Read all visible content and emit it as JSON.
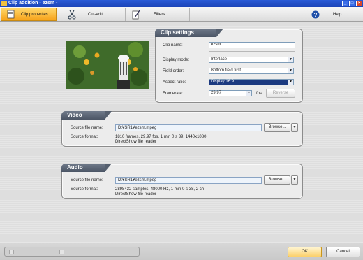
{
  "window": {
    "title": "Clip addition - ezsm -"
  },
  "toolbar": {
    "clip_properties": "Clip properties",
    "cut_edit": "Cut-edit",
    "filters": "Filters",
    "help": "Help..."
  },
  "clip_settings": {
    "title": "Clip settings",
    "clip_name_label": "Clip name:",
    "clip_name_value": "ezsm",
    "display_mode_label": "Display mode:",
    "display_mode_value": "Interlace",
    "field_order_label": "Field order:",
    "field_order_value": "Bottom field first",
    "aspect_ratio_label": "Aspect ratio:",
    "aspect_ratio_value": "Display 16:9",
    "framerate_label": "Framerate:",
    "framerate_value": "29.97",
    "framerate_unit": "fps",
    "reverse_button": "Reverse"
  },
  "video": {
    "title": "Video",
    "source_file_label": "Source file name:",
    "source_file_value": "D:¥SR1¥ezsm.mpeg",
    "browse_button": "Browse...",
    "source_format_label": "Source format:",
    "source_format_line1": "1810 frames, 29.97 fps, 1 min 0 s 39, 1440x1080",
    "source_format_line2": "DirectShow file reader"
  },
  "audio": {
    "title": "Audio",
    "source_file_label": "Source file name:",
    "source_file_value": "D:¥SR1¥ezsm.mpeg",
    "browse_button": "Browse...",
    "source_format_label": "Source format:",
    "source_format_line1": "2898432 samples, 48000 Hz, 1 min 0 s 38, 2 ch",
    "source_format_line2": "DirectShow file reader"
  },
  "bottom": {
    "ok": "OK",
    "cancel": "Cancel"
  }
}
